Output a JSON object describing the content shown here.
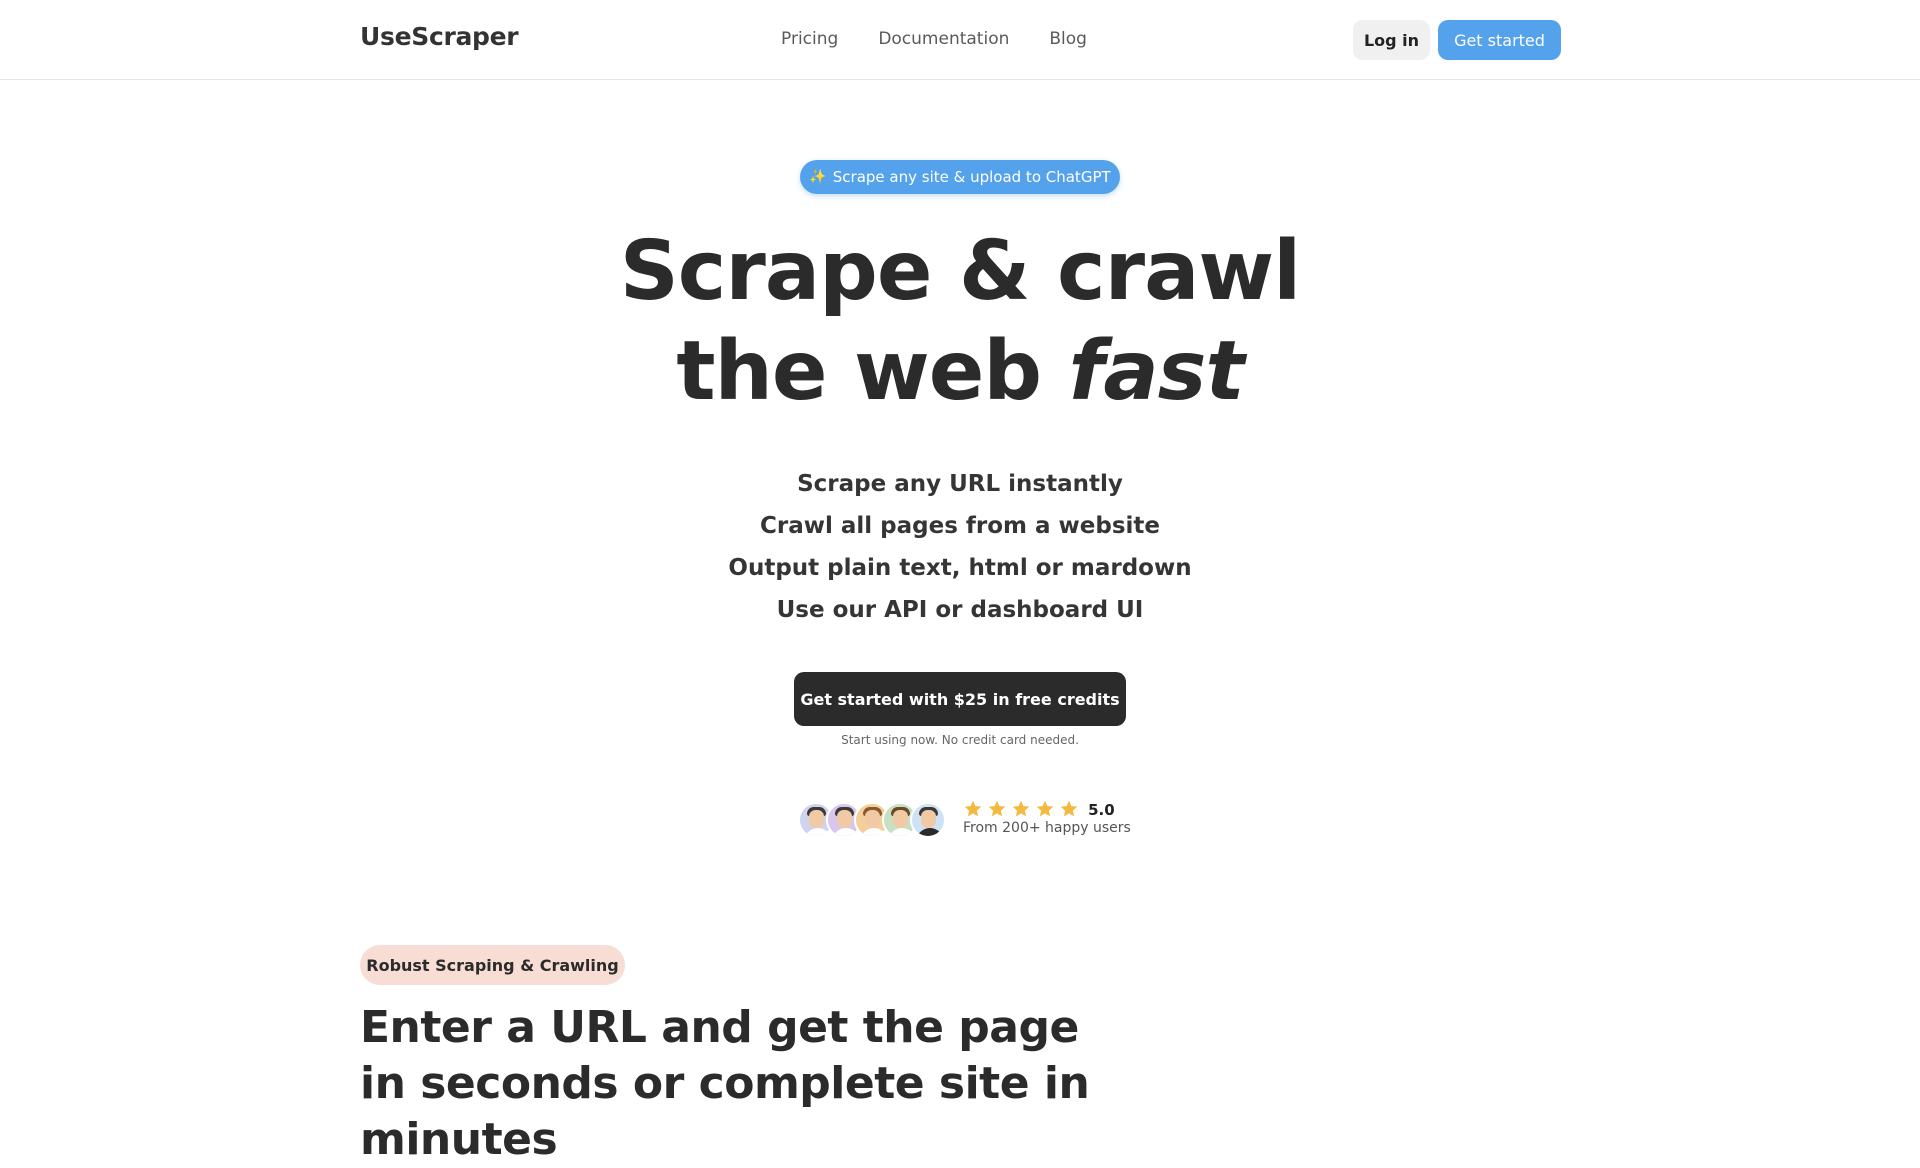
{
  "header": {
    "logo": "UseScraper",
    "nav": [
      "Pricing",
      "Documentation",
      "Blog"
    ],
    "login_label": "Log in",
    "get_started_label": "Get started"
  },
  "hero": {
    "badge_icon": "sparkles-icon",
    "badge_label": "Scrape any site & upload to ChatGPT",
    "title_line1": "Scrape & crawl",
    "title_line2_prefix": "the web ",
    "title_line2_emphasis": "fast",
    "features": [
      "Scrape any URL instantly",
      "Crawl all pages from a website",
      "Output plain text, html or mardown",
      "Use our API or dashboard UI"
    ],
    "cta_label": "Get started with $25 in free credits",
    "cta_note": "Start using now. No credit card needed."
  },
  "social_proof": {
    "avatars": [
      "user-avatar",
      "user-avatar",
      "user-avatar",
      "user-avatar",
      "user-avatar"
    ],
    "stars": 5,
    "star_color": "#f5b942",
    "score": "5.0",
    "note": "From 200+ happy users"
  },
  "section": {
    "badge": "Robust Scraping & Crawling",
    "title": "Enter a URL and get the page in seconds or complete site in minutes"
  },
  "colors": {
    "accent": "#54a2ec",
    "dark": "#2b2b2b",
    "badge_bg": "#f7ddd4"
  }
}
